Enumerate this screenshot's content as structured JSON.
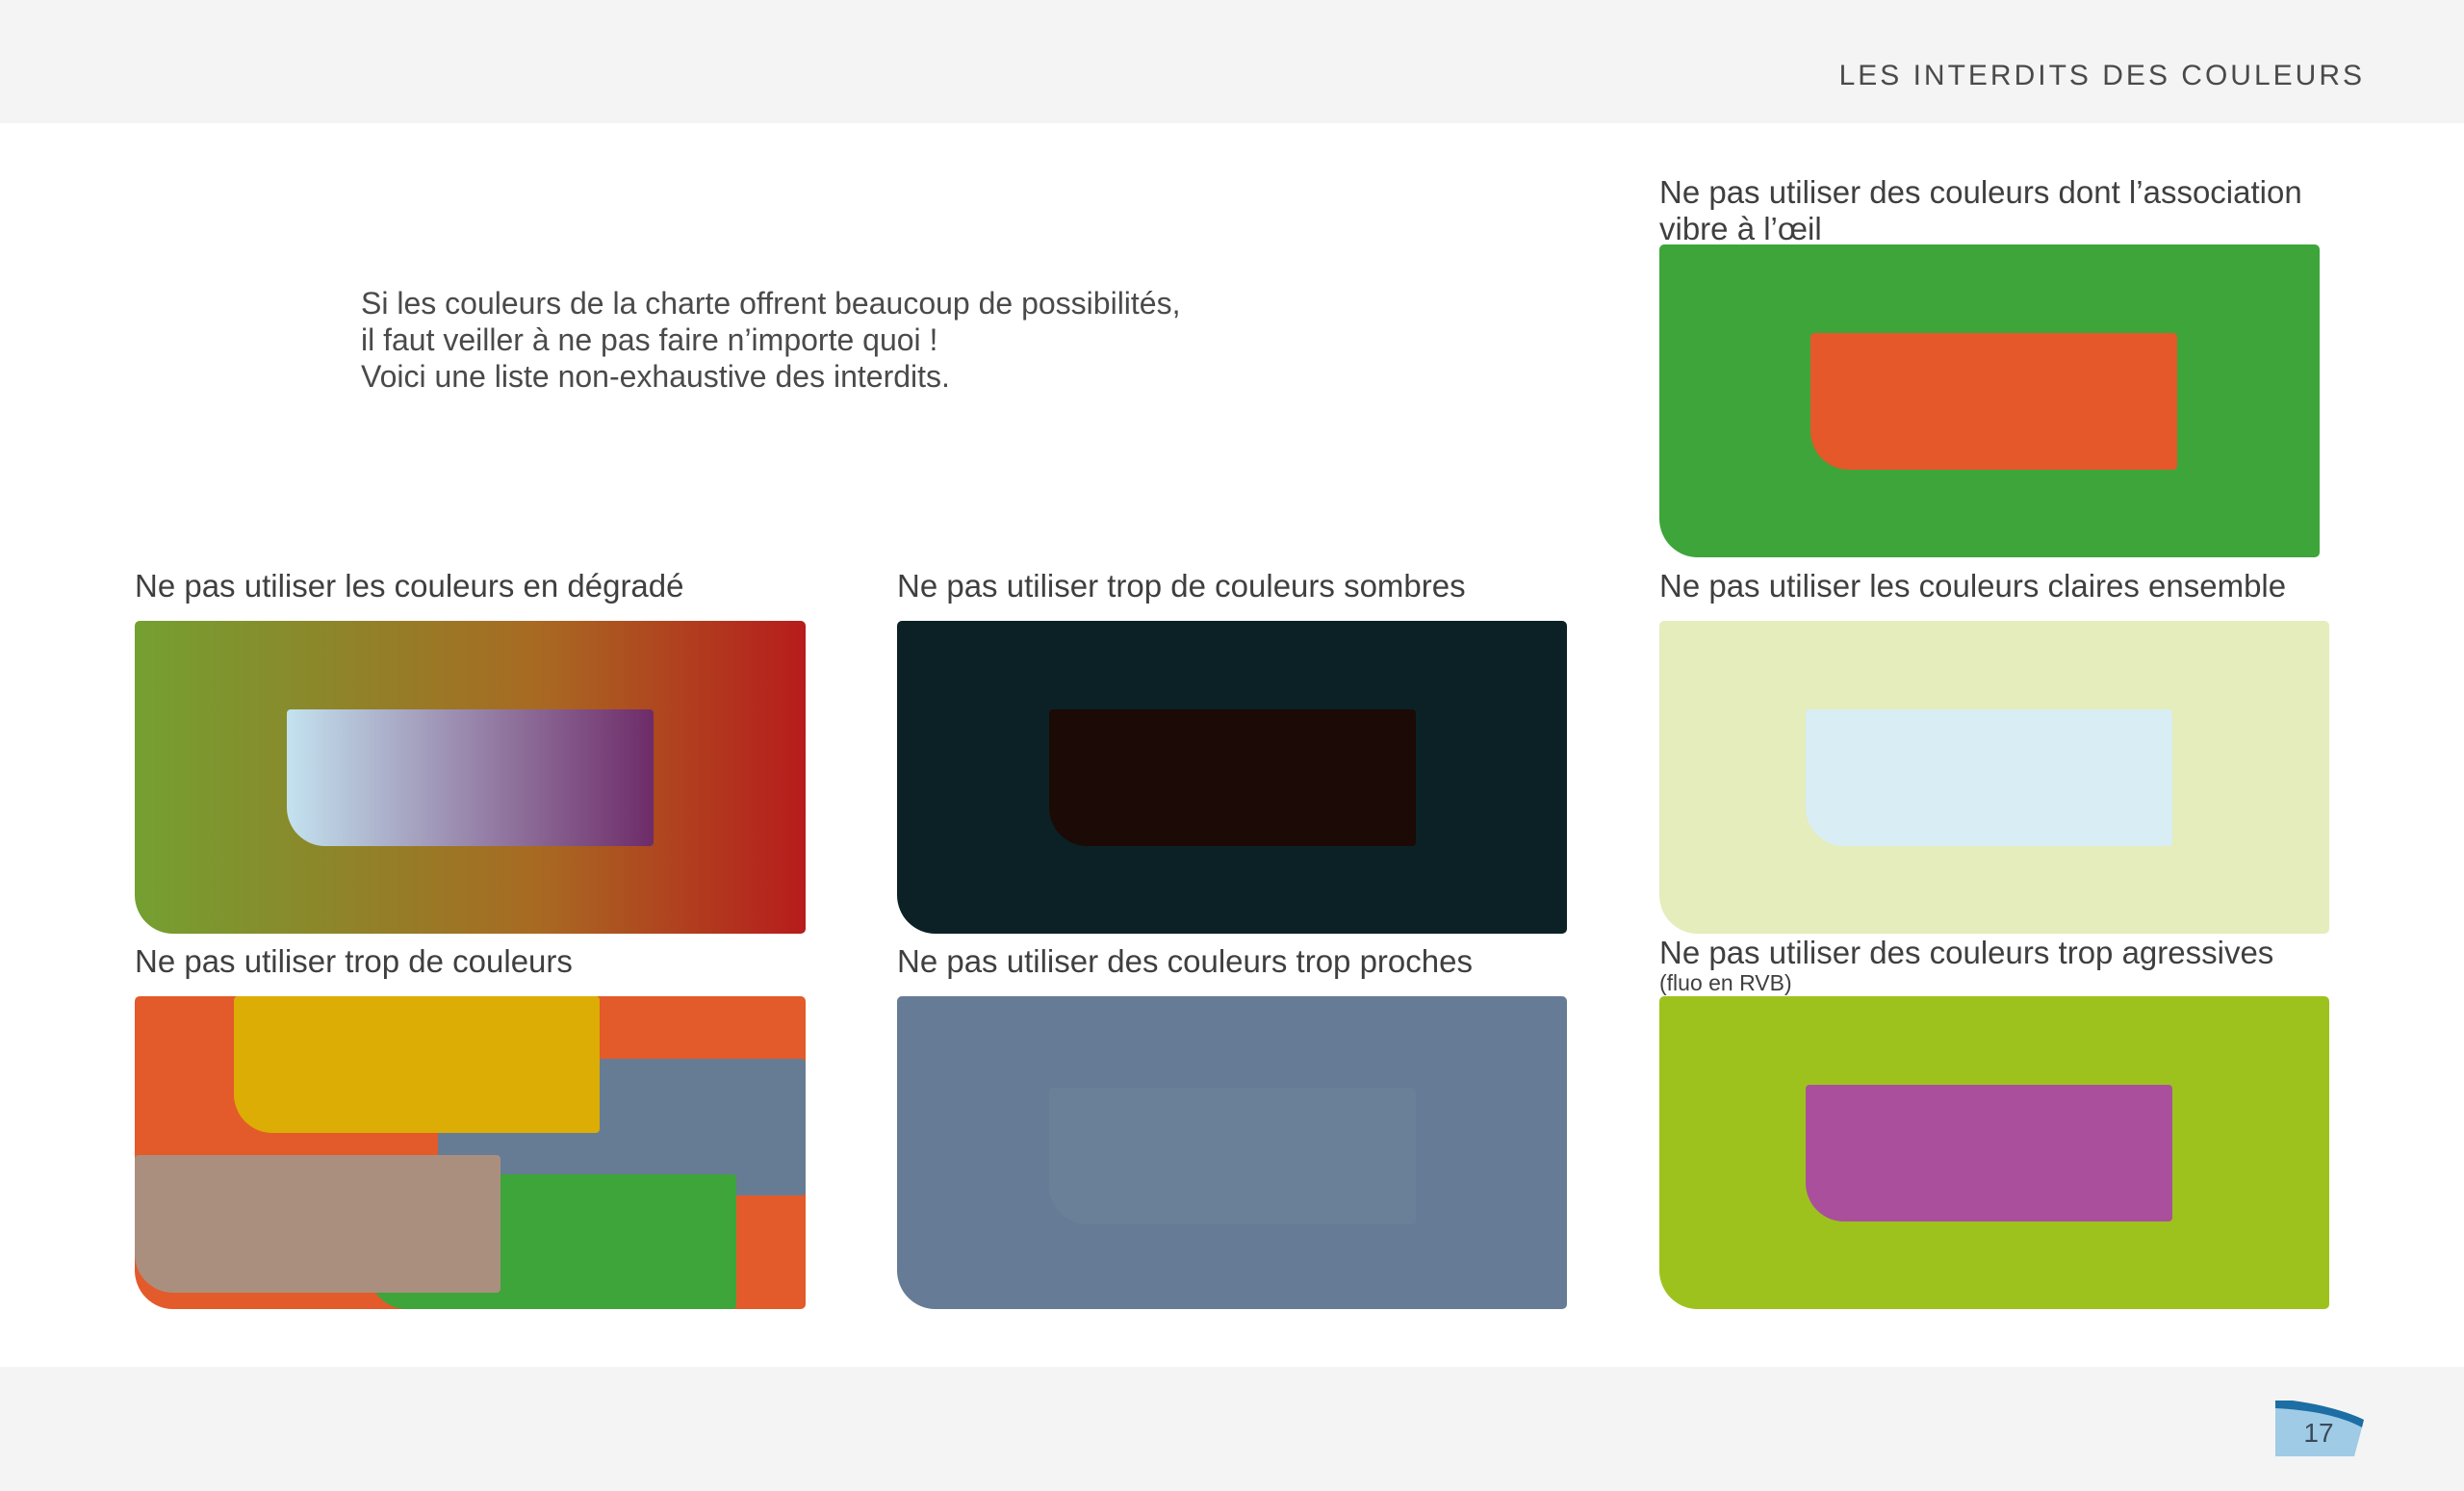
{
  "header": {
    "title": "LES INTERDITS DES COULEURS"
  },
  "intro": {
    "lines": [
      "Si les couleurs de la charte offrent beaucoup de possibilités,",
      "il faut veiller à ne pas faire n’importe quoi !",
      "Voici une liste non-exhaustive des interdits."
    ]
  },
  "rules": {
    "vibrate": {
      "label_line1": "Ne pas utiliser des couleurs dont l’association",
      "label_line2": "vibre à l’œil",
      "colors": {
        "background": "#3ea53a",
        "inner": "#e4582a"
      }
    },
    "gradient": {
      "label": "Ne pas utiliser les couleurs en dégradé",
      "colors": {
        "bg_from": "#74a031",
        "bg_to": "#b71c1c",
        "inner_from": "#c3e2ef",
        "inner_to": "#6e2b68"
      }
    },
    "dark": {
      "label": "Ne pas utiliser trop de couleurs sombres",
      "colors": {
        "background": "#0c2126",
        "inner": "#1b0a05"
      }
    },
    "light": {
      "label": "Ne pas utiliser les couleurs claires ensemble",
      "colors": {
        "background": "#e4edbb",
        "inner": "#d9edf4"
      }
    },
    "too_many": {
      "label": "Ne pas utiliser trop de couleurs",
      "colors": {
        "orange": "#e35a2b",
        "yellow": "#dcad04",
        "slate": "#667c95",
        "green": "#3ea53a",
        "taupe": "#ab8f7e"
      }
    },
    "too_close": {
      "label": "Ne pas utiliser des couleurs trop proches",
      "colors": {
        "background": "#667b95",
        "inner": "#6a8099"
      }
    },
    "aggressive": {
      "label": "Ne pas utiliser des couleurs trop agressives",
      "sublabel": "(fluo en RVB)",
      "colors": {
        "background": "#9dc21e",
        "inner": "#aa4f9b"
      }
    }
  },
  "footer": {
    "page_number": "17",
    "tab_color": "#9fcbe6",
    "tab_accent": "#1c6ea4"
  }
}
